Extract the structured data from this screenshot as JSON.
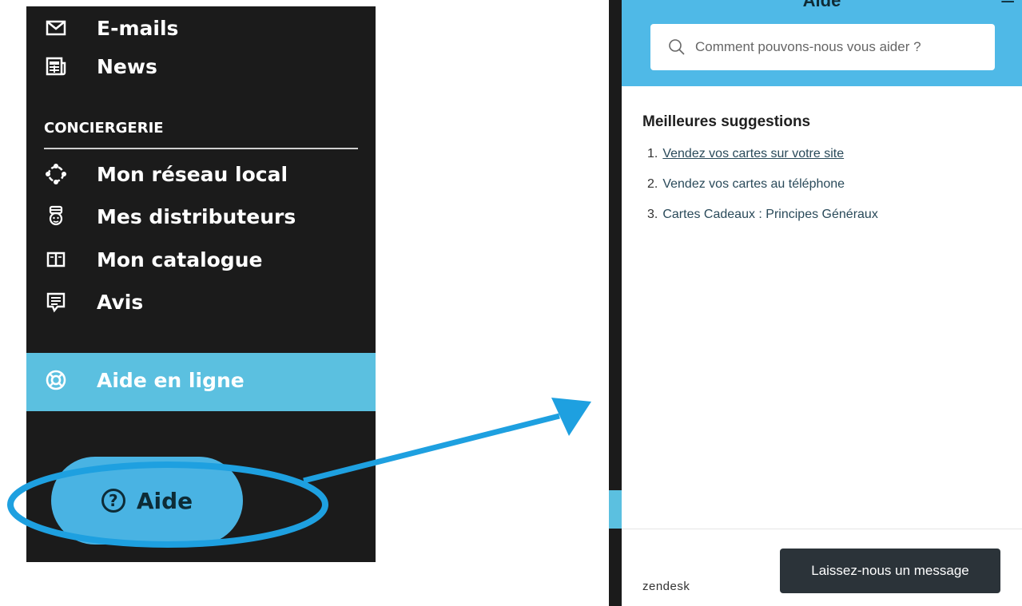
{
  "sidebar": {
    "items_top": [
      {
        "label": "E-mails",
        "icon": "mail-icon"
      },
      {
        "label": "News",
        "icon": "newspaper-icon"
      }
    ],
    "section_title": "CONCIERGERIE",
    "items": [
      {
        "label": "Mon réseau local",
        "icon": "network-icon"
      },
      {
        "label": "Mes distributeurs",
        "icon": "distributor-icon"
      },
      {
        "label": "Mon catalogue",
        "icon": "book-icon"
      },
      {
        "label": "Avis",
        "icon": "comment-icon"
      }
    ],
    "active_item": {
      "label": "Aide en ligne",
      "icon": "lifebuoy-icon"
    },
    "help_button": {
      "label": "Aide",
      "icon": "question-icon"
    }
  },
  "widget": {
    "title": "Aide",
    "minimize": "–",
    "search": {
      "placeholder": "Comment pouvons-nous vous aider ?"
    },
    "suggestions_title": "Meilleures suggestions",
    "suggestions": [
      {
        "num": "1.",
        "label": "Vendez vos cartes sur votre site"
      },
      {
        "num": "2.",
        "label": "Vendez vos cartes au téléphone"
      },
      {
        "num": "3.",
        "label": "Cartes Cadeaux : Principes Généraux"
      }
    ],
    "brand": "zendesk",
    "message_button": "Laissez-nous un message"
  },
  "colors": {
    "sidebar_bg": "#1b1b1b",
    "active_bg": "#5bc0e0",
    "help_button_bg": "#49b3e3",
    "widget_header_bg": "#4fb9e7",
    "annotation": "#1ea0e0",
    "message_button_bg": "#2b3339"
  }
}
